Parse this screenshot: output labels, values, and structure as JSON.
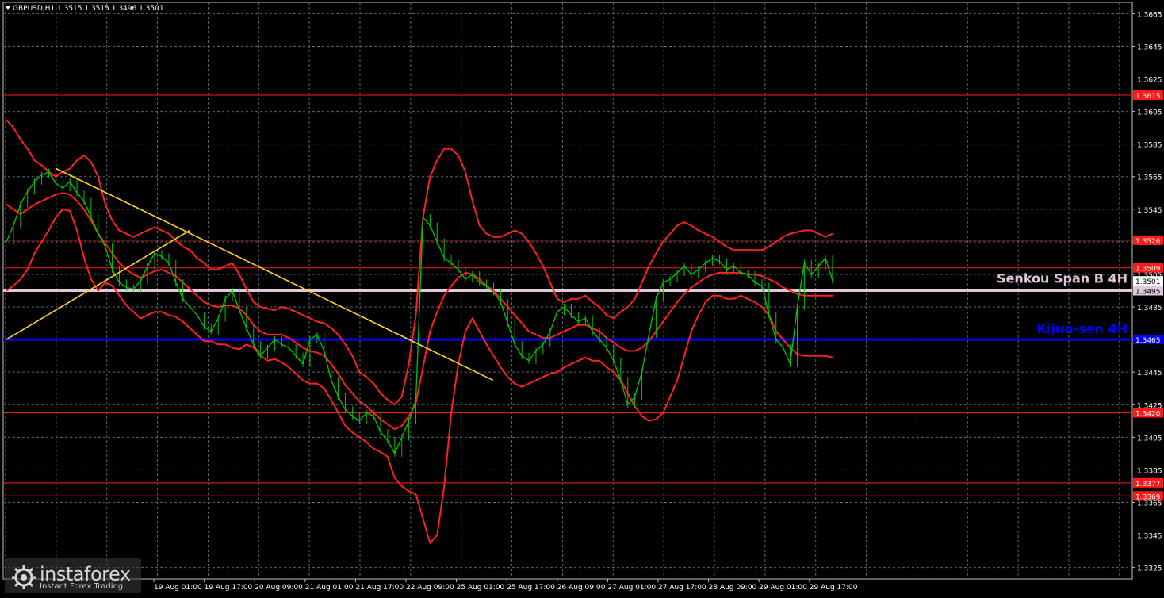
{
  "chart_data": {
    "type": "line",
    "title": "GBPUSD,H1  1.3515 1.3515 1.3496 1.3501",
    "symbol": "GBPUSD",
    "timeframe": "H1",
    "ohlc": {
      "open": 1.3515,
      "high": 1.3515,
      "low": 1.3496,
      "close": 1.3501
    },
    "ylim": [
      1.3318,
      1.3672
    ],
    "y_ticks": [
      "1.3665",
      "1.3645",
      "1.3625",
      "1.3605",
      "1.3585",
      "1.3565",
      "1.3545",
      "1.3525",
      "1.3505",
      "1.3485",
      "1.3465",
      "1.3445",
      "1.3425",
      "1.3405",
      "1.3385",
      "1.3365",
      "1.3345",
      "1.3325"
    ],
    "x_ticks": [
      "19 Aug 01:00",
      "19 Aug 17:00",
      "20 Aug 09:00",
      "21 Aug 01:00",
      "21 Aug 17:00",
      "22 Aug 09:00",
      "25 Aug 01:00",
      "25 Aug 17:00",
      "26 Aug 09:00",
      "27 Aug 01:00",
      "27 Aug 17:00",
      "28 Aug 09:00",
      "29 Aug 01:00",
      "29 Aug 17:00"
    ],
    "levels": [
      {
        "label": "1.3615",
        "value": 1.3615,
        "color": "#ff1a1a"
      },
      {
        "label": "1.3526",
        "value": 1.3526,
        "color": "#ff1a1a"
      },
      {
        "label": "1.3509",
        "value": 1.3509,
        "color": "#ff1a1a"
      },
      {
        "label": "1.3420",
        "value": 1.342,
        "color": "#ff1a1a"
      },
      {
        "label": "1.3377",
        "value": 1.3377,
        "color": "#ff1a1a"
      },
      {
        "label": "1.3369",
        "value": 1.3369,
        "color": "#ff1a1a"
      }
    ],
    "senkou_span_b": {
      "name": "Senkou Span B 4H",
      "value": 1.3495,
      "label": "1.3495",
      "color": "#e0c8d8"
    },
    "kijun_sen": {
      "name": "Kijun-sen 4H",
      "value": 1.3465,
      "label": "1.3465",
      "color": "#0000ff"
    },
    "current_price": {
      "label": "1.3501",
      "value": 1.3501
    },
    "price_series": {
      "color": "#00c800",
      "values": [
        1.3525,
        1.3535,
        1.3548,
        1.3556,
        1.3562,
        1.3566,
        1.3568,
        1.3561,
        1.3558,
        1.3562,
        1.3555,
        1.355,
        1.354,
        1.353,
        1.3522,
        1.3508,
        1.35,
        1.3497,
        1.3496,
        1.3501,
        1.351,
        1.3518,
        1.3516,
        1.3512,
        1.35,
        1.349,
        1.3485,
        1.348,
        1.3473,
        1.347,
        1.3478,
        1.349,
        1.3495,
        1.3483,
        1.3472,
        1.3462,
        1.3455,
        1.346,
        1.3465,
        1.3462,
        1.346,
        1.3455,
        1.345,
        1.3465,
        1.3468,
        1.3458,
        1.344,
        1.343,
        1.3422,
        1.3418,
        1.3415,
        1.342,
        1.3418,
        1.3408,
        1.3403,
        1.3395,
        1.3405,
        1.3415,
        1.3428,
        1.354,
        1.3535,
        1.3525,
        1.3515,
        1.3512,
        1.3508,
        1.3502,
        1.3505,
        1.35,
        1.3498,
        1.3494,
        1.3488,
        1.3475,
        1.3462,
        1.3455,
        1.3452,
        1.3458,
        1.3462,
        1.347,
        1.3482,
        1.3485,
        1.348,
        1.3476,
        1.3478,
        1.347,
        1.3465,
        1.346,
        1.3452,
        1.344,
        1.3425,
        1.343,
        1.3445,
        1.3468,
        1.349,
        1.35,
        1.3502,
        1.3506,
        1.351,
        1.3505,
        1.3508,
        1.3512,
        1.3515,
        1.3513,
        1.3508,
        1.351,
        1.3506,
        1.3505,
        1.35,
        1.3498,
        1.348,
        1.3465,
        1.346,
        1.345,
        1.3485,
        1.3512,
        1.3505,
        1.351,
        1.3515,
        1.3501
      ]
    },
    "bollinger_upper": [
      1.36,
      1.3595,
      1.3588,
      1.3582,
      1.3575,
      1.3572,
      1.3568,
      1.3565,
      1.3568,
      1.357,
      1.3575,
      1.3578,
      1.3574,
      1.3565,
      1.3548,
      1.3538,
      1.3532,
      1.353,
      1.3528,
      1.353,
      1.3532,
      1.3534,
      1.3532,
      1.353,
      1.3526,
      1.3522,
      1.352,
      1.3515,
      1.3512,
      1.3508,
      1.3508,
      1.351,
      1.3512,
      1.3505,
      1.3496,
      1.3488,
      1.3485,
      1.3484,
      1.3483,
      1.3485,
      1.3484,
      1.3482,
      1.348,
      1.3478,
      1.3476,
      1.3475,
      1.3472,
      1.3468,
      1.3462,
      1.3455,
      1.3445,
      1.3442,
      1.3438,
      1.3432,
      1.3428,
      1.3425,
      1.343,
      1.345,
      1.348,
      1.354,
      1.3565,
      1.3575,
      1.3582,
      1.3582,
      1.3578,
      1.3568,
      1.355,
      1.3535,
      1.353,
      1.3528,
      1.3528,
      1.353,
      1.3532,
      1.353,
      1.3525,
      1.3518,
      1.351,
      1.35,
      1.349,
      1.3488,
      1.349,
      1.349,
      1.3492,
      1.3488,
      1.3485,
      1.348,
      1.3478,
      1.3482,
      1.3485,
      1.349,
      1.35,
      1.351,
      1.3518,
      1.3525,
      1.353,
      1.3535,
      1.3537,
      1.3535,
      1.3532,
      1.353,
      1.3528,
      1.3525,
      1.3522,
      1.352,
      1.352,
      1.352,
      1.352,
      1.352,
      1.3522,
      1.3525,
      1.3528,
      1.353,
      1.3531,
      1.3532,
      1.3532,
      1.353,
      1.3528,
      1.353
    ],
    "bollinger_middle": [
      1.3548,
      1.3545,
      1.3542,
      1.3545,
      1.3548,
      1.355,
      1.3552,
      1.3554,
      1.3555,
      1.3554,
      1.355,
      1.3545,
      1.3538,
      1.353,
      1.3524,
      1.3518,
      1.3512,
      1.3508,
      1.3505,
      1.3503,
      1.3505,
      1.3507,
      1.3508,
      1.3506,
      1.3504,
      1.35,
      1.3496,
      1.3492,
      1.3488,
      1.3486,
      1.3485,
      1.3486,
      1.3486,
      1.3484,
      1.348,
      1.3474,
      1.347,
      1.3468,
      1.3468,
      1.3468,
      1.3466,
      1.3463,
      1.346,
      1.3458,
      1.3457,
      1.3455,
      1.345,
      1.3444,
      1.3437,
      1.3432,
      1.3427,
      1.3424,
      1.342,
      1.3416,
      1.3413,
      1.341,
      1.3412,
      1.3418,
      1.3426,
      1.3448,
      1.347,
      1.3482,
      1.3492,
      1.3498,
      1.3503,
      1.3506,
      1.3505,
      1.3502,
      1.3498,
      1.3495,
      1.349,
      1.3485,
      1.348,
      1.3475,
      1.347,
      1.3468,
      1.3466,
      1.3466,
      1.3468,
      1.347,
      1.3472,
      1.3474,
      1.3474,
      1.3472,
      1.347,
      1.3466,
      1.3463,
      1.346,
      1.3458,
      1.3458,
      1.346,
      1.3464,
      1.347,
      1.3476,
      1.3482,
      1.3488,
      1.3493,
      1.3497,
      1.35,
      1.3503,
      1.3505,
      1.3506,
      1.3506,
      1.3506,
      1.3506,
      1.3505,
      1.3505,
      1.3504,
      1.3502,
      1.35,
      1.3497,
      1.3495,
      1.3493,
      1.3492,
      1.3492,
      1.3492,
      1.3492,
      1.3492
    ],
    "bollinger_lower": [
      1.3495,
      1.3498,
      1.3502,
      1.3508,
      1.3518,
      1.3525,
      1.3532,
      1.354,
      1.3545,
      1.3544,
      1.3532,
      1.3515,
      1.3502,
      1.3495,
      1.35,
      1.3498,
      1.3492,
      1.3486,
      1.3482,
      1.3478,
      1.348,
      1.3482,
      1.3482,
      1.348,
      1.3479,
      1.3476,
      1.3472,
      1.3468,
      1.3464,
      1.3464,
      1.3462,
      1.3462,
      1.346,
      1.3459,
      1.3462,
      1.346,
      1.3455,
      1.3452,
      1.3453,
      1.3451,
      1.3448,
      1.3444,
      1.344,
      1.3438,
      1.3438,
      1.3435,
      1.3428,
      1.342,
      1.3412,
      1.3408,
      1.3405,
      1.3402,
      1.3398,
      1.3396,
      1.3393,
      1.338,
      1.3375,
      1.3372,
      1.337,
      1.3355,
      1.334,
      1.3345,
      1.3375,
      1.342,
      1.345,
      1.347,
      1.3478,
      1.347,
      1.3462,
      1.3455,
      1.3448,
      1.3442,
      1.3438,
      1.3436,
      1.3438,
      1.344,
      1.3442,
      1.3444,
      1.3445,
      1.3448,
      1.345,
      1.3452,
      1.3454,
      1.3452,
      1.3452,
      1.3448,
      1.3445,
      1.344,
      1.3432,
      1.3424,
      1.3418,
      1.3415,
      1.3416,
      1.342,
      1.343,
      1.344,
      1.3455,
      1.347,
      1.348,
      1.3488,
      1.3492,
      1.3492,
      1.349,
      1.349,
      1.3492,
      1.349,
      1.3488,
      1.3485,
      1.348,
      1.347,
      1.3465,
      1.346,
      1.3456,
      1.3455,
      1.3455,
      1.3455,
      1.3455,
      1.3454
    ],
    "trendlines": [
      {
        "x1": 0.044,
        "y1": 1.357,
        "x2": 0.43,
        "y2": 1.344
      },
      {
        "x1": 0.0,
        "y1": 1.3465,
        "x2": 0.162,
        "y2": 1.3532
      }
    ],
    "legend": "top-left"
  },
  "watermark": {
    "brand": "instaforex",
    "tagline": "Instant Forex Trading"
  }
}
